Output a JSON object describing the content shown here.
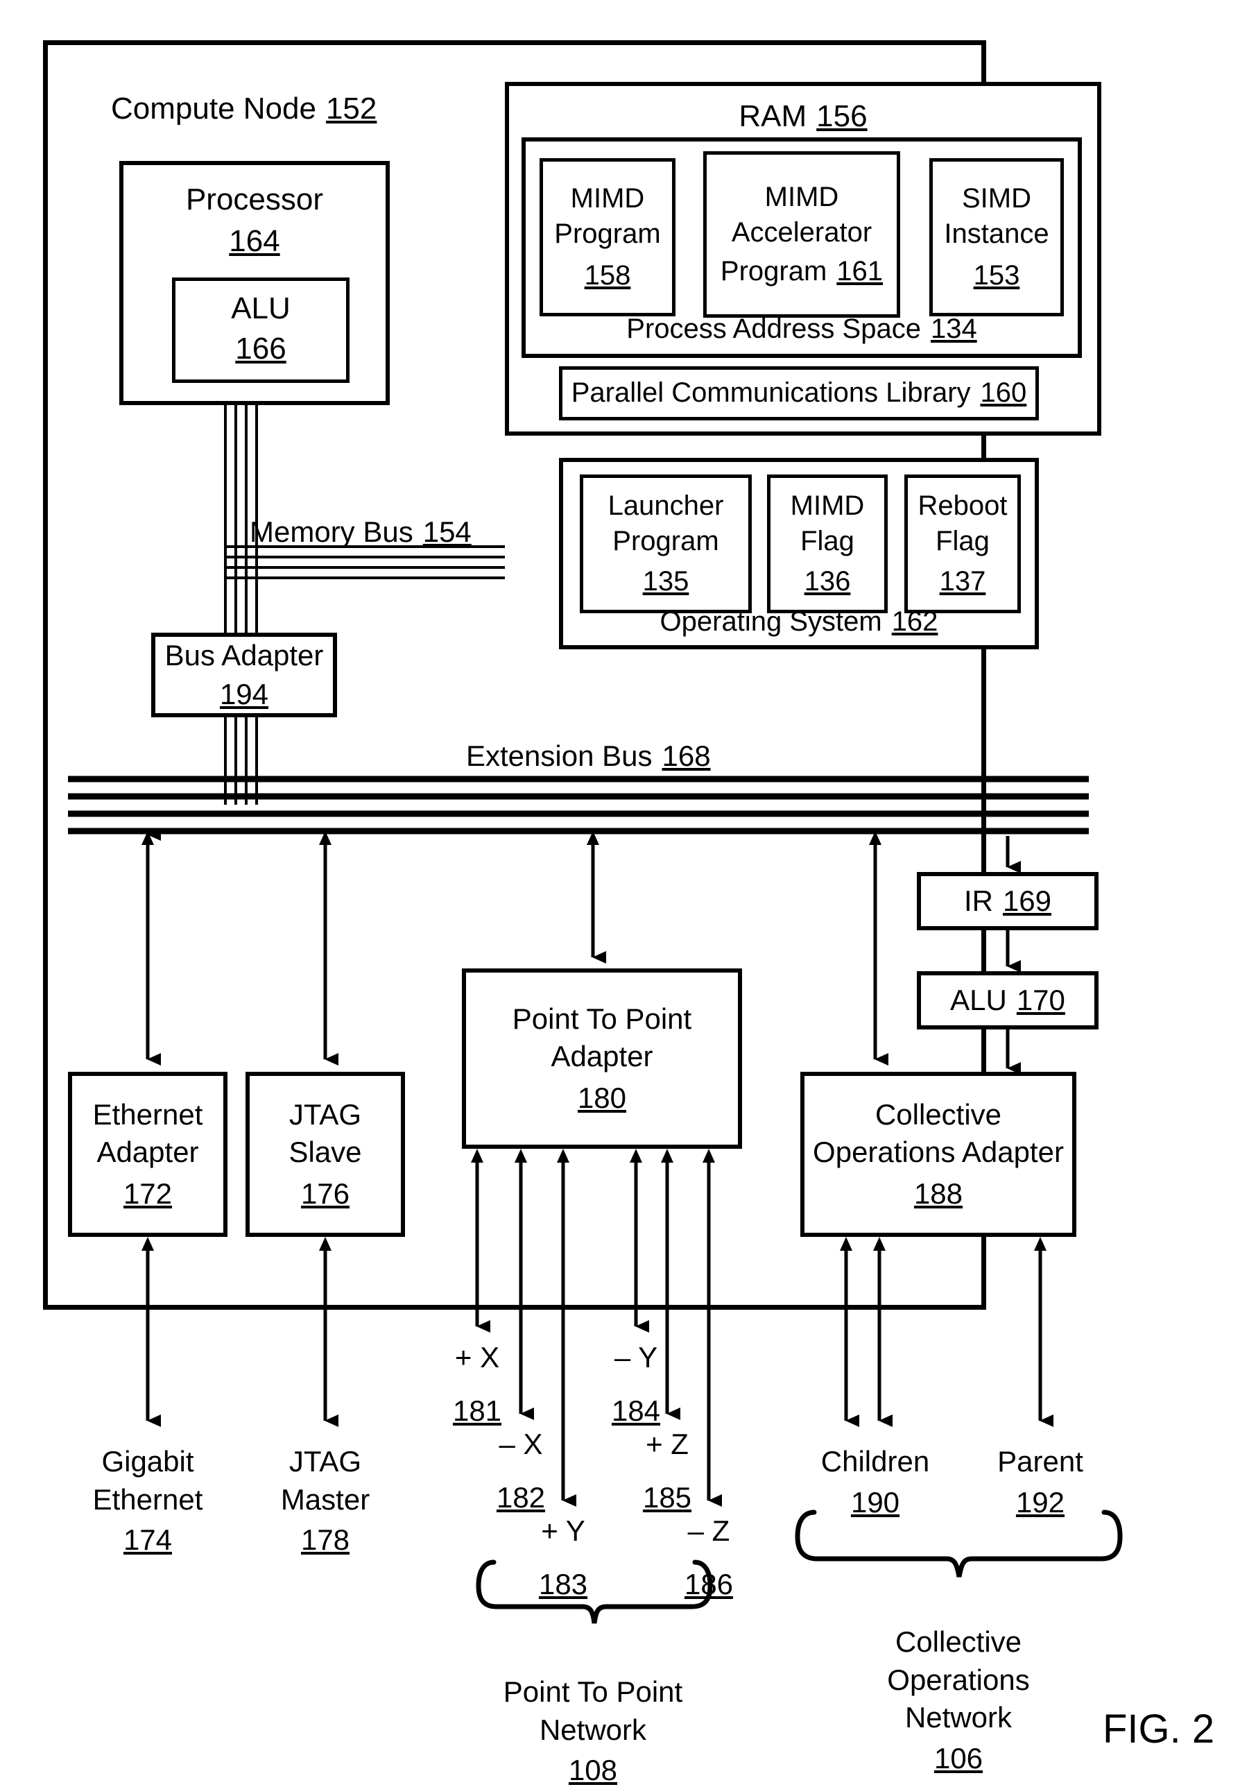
{
  "figure": {
    "label": "FIG. 2"
  },
  "outer": {
    "title": "Compute Node",
    "ref": "152"
  },
  "processor": {
    "title": "Processor",
    "ref": "164",
    "alu": {
      "title": "ALU",
      "ref": "166"
    }
  },
  "ram": {
    "title": "RAM",
    "ref": "156",
    "process_address_space": {
      "title": "Process Address Space",
      "ref": "134",
      "items": [
        {
          "line1": "MIMD",
          "line2": "Program",
          "ref": "158"
        },
        {
          "line1": "MIMD",
          "line2": "Accelerator",
          "line3": "Program",
          "ref": "161"
        },
        {
          "line1": "SIMD",
          "line2": "Instance",
          "ref": "153"
        }
      ]
    },
    "parallel_library": {
      "title": "Parallel Communications Library",
      "ref": "160"
    },
    "operating_system": {
      "title": "Operating System",
      "ref": "162",
      "items": [
        {
          "line1": "Launcher",
          "line2": "Program",
          "ref": "135"
        },
        {
          "line1": "MIMD",
          "line2": "Flag",
          "ref": "136"
        },
        {
          "line1": "Reboot",
          "line2": "Flag",
          "ref": "137"
        }
      ]
    }
  },
  "memory_bus": {
    "title": "Memory Bus",
    "ref": "154"
  },
  "bus_adapter": {
    "title": "Bus Adapter",
    "ref": "194"
  },
  "extension_bus": {
    "title": "Extension Bus",
    "ref": "168"
  },
  "adapters": {
    "ethernet": {
      "line1": "Ethernet",
      "line2": "Adapter",
      "ref": "172"
    },
    "jtag_slave": {
      "line1": "JTAG",
      "line2": "Slave",
      "ref": "176"
    },
    "point_to_point": {
      "line1": "Point To Point",
      "line2": "Adapter",
      "ref": "180"
    },
    "collective": {
      "line1": "Collective",
      "line2": "Operations Adapter",
      "ref": "188"
    },
    "ir": {
      "title": "IR",
      "ref": "169"
    },
    "alu2": {
      "title": "ALU",
      "ref": "170"
    }
  },
  "endpoints": {
    "gigabit_ethernet": {
      "line1": "Gigabit",
      "line2": "Ethernet",
      "ref": "174"
    },
    "jtag_master": {
      "line1": "JTAG",
      "line2": "Master",
      "ref": "178"
    },
    "children": {
      "title": "Children",
      "ref": "190"
    },
    "parent": {
      "title": "Parent",
      "ref": "192"
    }
  },
  "axes": [
    {
      "label": "+ X",
      "ref": "181"
    },
    {
      "label": "– X",
      "ref": "182"
    },
    {
      "label": "+ Y",
      "ref": "183"
    },
    {
      "label": "– Y",
      "ref": "184"
    },
    {
      "label": "+ Z",
      "ref": "185"
    },
    {
      "label": "– Z",
      "ref": "186"
    }
  ],
  "networks": {
    "point_to_point": {
      "line1": "Point To Point",
      "line2": "Network",
      "ref": "108"
    },
    "collective": {
      "line1": "Collective",
      "line2": "Operations",
      "line3": "Network",
      "ref": "106"
    }
  }
}
